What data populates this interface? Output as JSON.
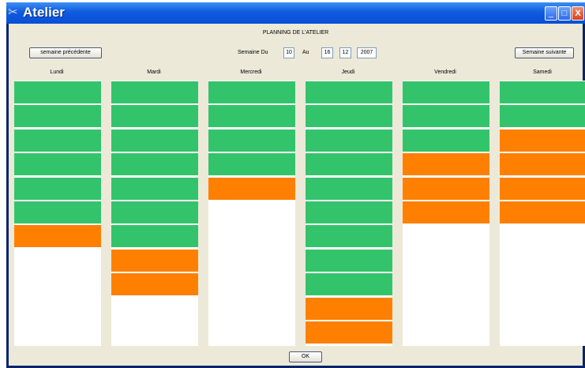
{
  "window": {
    "title": "Atelier",
    "icon": "scissors-icon",
    "buttons": {
      "minimize": "_",
      "maximize": "□",
      "close": "X"
    }
  },
  "header": {
    "title": "PLANNING DE L'ATELIER"
  },
  "nav": {
    "prev_label": "semaine précédente",
    "next_label": "Semaine suivante"
  },
  "week": {
    "semaine_du_label": "Semaine Du",
    "from_day": "10",
    "au_label": "Au",
    "to_day": "16",
    "month": "12",
    "year": "2007"
  },
  "colors": {
    "free": "#33c46b",
    "busy": "#ff8000"
  },
  "days": [
    {
      "name": "Lundi",
      "slots": [
        "free",
        "free",
        "free",
        "free",
        "free",
        "free",
        "busy"
      ]
    },
    {
      "name": "Mardi",
      "slots": [
        "free",
        "free",
        "free",
        "free",
        "free",
        "free",
        "free",
        "busy",
        "busy"
      ]
    },
    {
      "name": "Mercredi",
      "slots": [
        "free",
        "free",
        "free",
        "free",
        "busy"
      ]
    },
    {
      "name": "Jeudi",
      "slots": [
        "free",
        "free",
        "free",
        "free",
        "free",
        "free",
        "free",
        "free",
        "free",
        "busy",
        "busy"
      ]
    },
    {
      "name": "Vendredi",
      "slots": [
        "free",
        "free",
        "free",
        "busy",
        "busy",
        "busy"
      ]
    },
    {
      "name": "Samedi",
      "slots": [
        "free",
        "free",
        "busy",
        "busy",
        "busy",
        "busy"
      ]
    }
  ],
  "footer": {
    "ok_label": "OK"
  }
}
